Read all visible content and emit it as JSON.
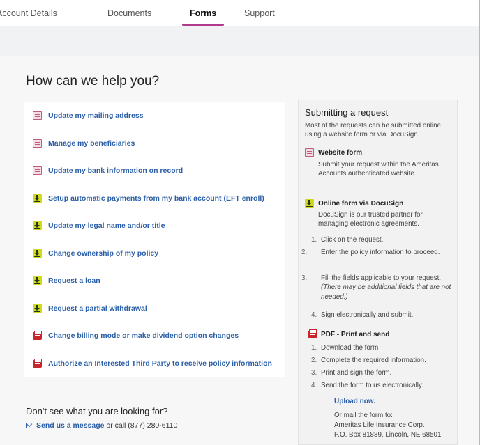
{
  "nav": {
    "tabs": [
      {
        "label": "Account Details"
      },
      {
        "label": "Documents"
      },
      {
        "label": "Forms"
      },
      {
        "label": "Support"
      }
    ],
    "active_tab": "Forms"
  },
  "main": {
    "heading": "How can we help you?",
    "requests": [
      {
        "icon": "website-form-icon",
        "label": "Update my mailing address"
      },
      {
        "icon": "website-form-icon",
        "label": "Manage my beneficiaries"
      },
      {
        "icon": "website-form-icon",
        "label": "Update my bank information on record"
      },
      {
        "icon": "docusign-icon",
        "label": "Setup automatic payments from my bank account (EFT enroll)"
      },
      {
        "icon": "docusign-icon",
        "label": "Update my legal name and/or title"
      },
      {
        "icon": "docusign-icon",
        "label": "Change ownership of my policy"
      },
      {
        "icon": "docusign-icon",
        "label": "Request a loan"
      },
      {
        "icon": "docusign-icon",
        "label": "Request a partial withdrawal"
      },
      {
        "icon": "pdf-icon",
        "label": "Change billing mode or make dividend option changes"
      },
      {
        "icon": "pdf-icon",
        "label": "Authorize an Interested Third Party to receive policy information"
      }
    ],
    "dont_see": "Don't see what you are looking for?",
    "message_link": "Send us a message",
    "call_text": " or call (877) 280-6110"
  },
  "panel": {
    "title": "Submitting a request",
    "intro": "Most of the requests can be submitted online, using a website form or via  DocuSign.",
    "website": {
      "title": "Website form",
      "desc": "Submit your request within the Ameritas Accounts authenticated website."
    },
    "docusign": {
      "title": "Online form via DocuSign",
      "desc": "DocuSign is our trusted partner for managing electronic agreements.",
      "steps": [
        {
          "n": "1.",
          "text": "Click on the request."
        },
        {
          "n": "2.",
          "text": "Enter the policy information to proceed."
        },
        {
          "n": "3.",
          "text": "Fill the fields applicable to your request.",
          "note": "(There may be additional fields that are not needed.)"
        },
        {
          "n": "4.",
          "text": "Sign electronically and submit."
        }
      ]
    },
    "pdf": {
      "title": "PDF - Print and send",
      "steps": [
        {
          "n": "1.",
          "text": "Download the form"
        },
        {
          "n": "2.",
          "text": "Complete the required information."
        },
        {
          "n": "3.",
          "text": "Print and sign the form."
        },
        {
          "n": "4.",
          "text": "Send the form to us electronically."
        }
      ],
      "upload_link": "Upload now.",
      "mail_intro": "Or mail the form to:",
      "mail_line1": "Ameritas Life Insurance Corp.",
      "mail_line2": "P.O. Box 81889, Lincoln, NE 68501"
    }
  },
  "colors": {
    "accent_tab": "#b23a8c",
    "link_blue": "#2b5fa8",
    "docusign_yellow": "#d3d81e",
    "pdf_red": "#c8262d",
    "website_pink": "#c25b7a"
  }
}
